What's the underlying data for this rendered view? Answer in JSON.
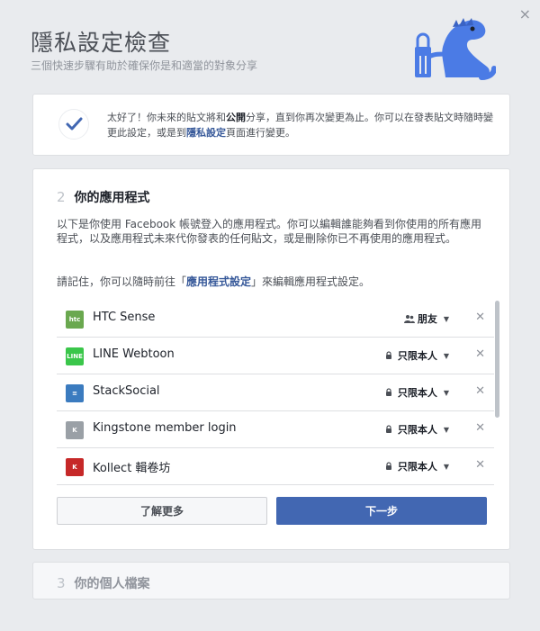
{
  "header": {
    "title": "隱私設定檢查",
    "subtitle": "三個快速步驟有助於確保你是和適當的對象分享",
    "close_glyph": "×"
  },
  "step1": {
    "text_before": "太好了！你未來的貼文將和",
    "text_bold": "公開",
    "text_middle": "分享，直到你再次變更為止。你可以在發表貼文時隨時變更此設定，或是到",
    "link": "隱私設定",
    "text_after": "頁面進行變更。"
  },
  "step2": {
    "number": "2",
    "title": "你的應用程式",
    "description": "以下是你使用 Facebook 帳號登入的應用程式。你可以編輯誰能夠看到你使用的所有應用程式，以及應用程式未來代你發表的任何貼文，或是刪除你已不再使用的應用程式。",
    "remember_before": "請記住，你可以隨時前往「",
    "remember_link": "應用程式設定",
    "remember_after": "」來編輯應用程式設定。",
    "apps": [
      {
        "name": "HTC Sense",
        "audience": "朋友",
        "audience_icon": "friends-icon",
        "icon_label": "htc",
        "color": "#6aa84f"
      },
      {
        "name": "LINE Webtoon",
        "audience": "只限本人",
        "audience_icon": "lock-icon",
        "icon_label": "LINE",
        "color": "#3ac64a"
      },
      {
        "name": "StackSocial",
        "audience": "只限本人",
        "audience_icon": "lock-icon",
        "icon_label": "≡",
        "color": "#3b7bbf"
      },
      {
        "name": "Kingstone member login",
        "audience": "只限本人",
        "audience_icon": "lock-icon",
        "icon_label": "K",
        "color": "#9aa0a6"
      },
      {
        "name": "Kollect 輯卷坊",
        "audience": "只限本人",
        "audience_icon": "lock-icon",
        "icon_label": "K",
        "color": "#c62828"
      }
    ],
    "learn_more": "了解更多",
    "next": "下一步"
  },
  "step3": {
    "number": "3",
    "title": "你的個人檔案"
  },
  "colors": {
    "accent": "#4267b2",
    "link": "#365899",
    "mascot": "#4b7be5"
  }
}
